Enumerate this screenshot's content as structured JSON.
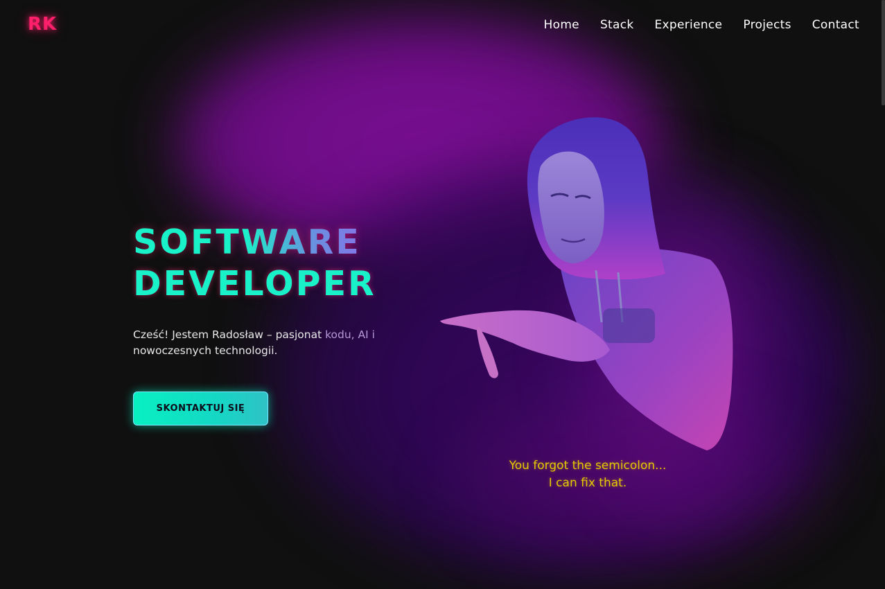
{
  "brand": {
    "logo": "RK",
    "logo_color": "#ff1f6b"
  },
  "nav": {
    "items": [
      {
        "label": "Home"
      },
      {
        "label": "Stack"
      },
      {
        "label": "Experience"
      },
      {
        "label": "Projects"
      },
      {
        "label": "Contact"
      }
    ]
  },
  "hero": {
    "title_line_1": "SOFTWARE",
    "title_line_2": "DEVELOPER",
    "intro_main": "Cześć! Jestem Radosław – pasjonat ",
    "intro_fade": "kodu, AI i",
    "intro_rest": "nowoczesnych technologii.",
    "cta_label": "SKONTAKTUJ SIĘ"
  },
  "quote": {
    "line_1": "You forgot the semicolon...",
    "line_2": "I can fix that."
  },
  "colors": {
    "accent_teal": "#19f2c8",
    "accent_pink": "#ff1f6b",
    "quote_yellow": "#e6c800",
    "glow_purple": "#7a0f92",
    "background": "#101010"
  },
  "icons": [
    "hooded-developer-portrait"
  ]
}
